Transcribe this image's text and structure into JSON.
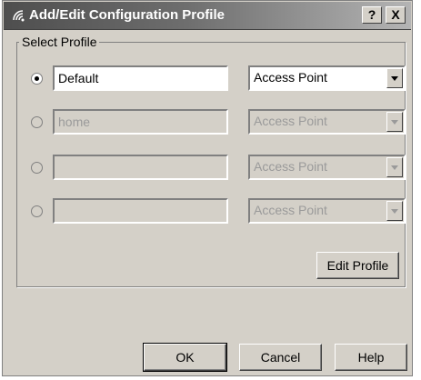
{
  "window": {
    "title": "Add/Edit Configuration Profile",
    "help_label": "?",
    "close_label": "X",
    "icon": "wireless-signal-icon"
  },
  "group": {
    "label": "Select Profile",
    "profiles": [
      {
        "name": "Default",
        "mode": "Access Point",
        "selected": true,
        "enabled": true
      },
      {
        "name": "home",
        "mode": "Access Point",
        "selected": false,
        "enabled": false
      },
      {
        "name": "",
        "mode": "Access Point",
        "selected": false,
        "enabled": false
      },
      {
        "name": "",
        "mode": "Access Point",
        "selected": false,
        "enabled": false
      }
    ],
    "edit_label": "Edit Profile"
  },
  "buttons": {
    "ok": "OK",
    "cancel": "Cancel",
    "help": "Help"
  }
}
